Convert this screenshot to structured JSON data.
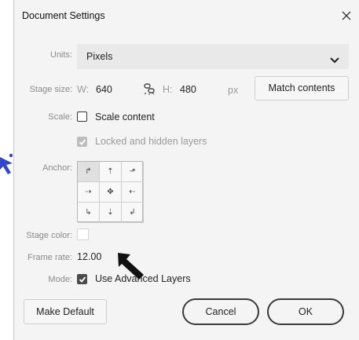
{
  "dialog": {
    "title": "Document Settings",
    "close_glyph": "✕",
    "units": {
      "label": "Units:",
      "value": "Pixels"
    },
    "stage_size": {
      "label": "Stage size:",
      "w_label": "W:",
      "w_value": "640",
      "h_label": "H:",
      "h_value": "480",
      "unit": "px",
      "match_button": "Match contents"
    },
    "scale": {
      "label": "Scale:",
      "scale_content": {
        "label": "Scale content",
        "checked": false
      },
      "locked_hidden": {
        "label": "Locked and hidden layers",
        "checked": true,
        "disabled": true
      }
    },
    "anchor": {
      "label": "Anchor:",
      "cells": [
        "↱",
        "⇡",
        "⬏",
        "⇢",
        "✥",
        "⇠",
        "↳",
        "⇣",
        "↲"
      ],
      "selected_index": 0
    },
    "stage_color": {
      "label": "Stage color:",
      "color": "#ffffff"
    },
    "frame_rate": {
      "label": "Frame rate:",
      "value": "12.00"
    },
    "mode": {
      "label": "Mode:",
      "value": "Use Advanced Layers",
      "checked": true
    },
    "buttons": {
      "make_default": "Make Default",
      "cancel": "Cancel",
      "ok": "OK"
    }
  },
  "icons": {
    "link": "chain-link-icon",
    "chevron": "chevron-down-icon",
    "close": "close-icon",
    "pointer": "black-arrow-pointer-icon"
  },
  "colors": {
    "checkbox_on": "#4a4a4a",
    "label": "#8a8a8a",
    "pill_border": "#3a3a3a"
  }
}
